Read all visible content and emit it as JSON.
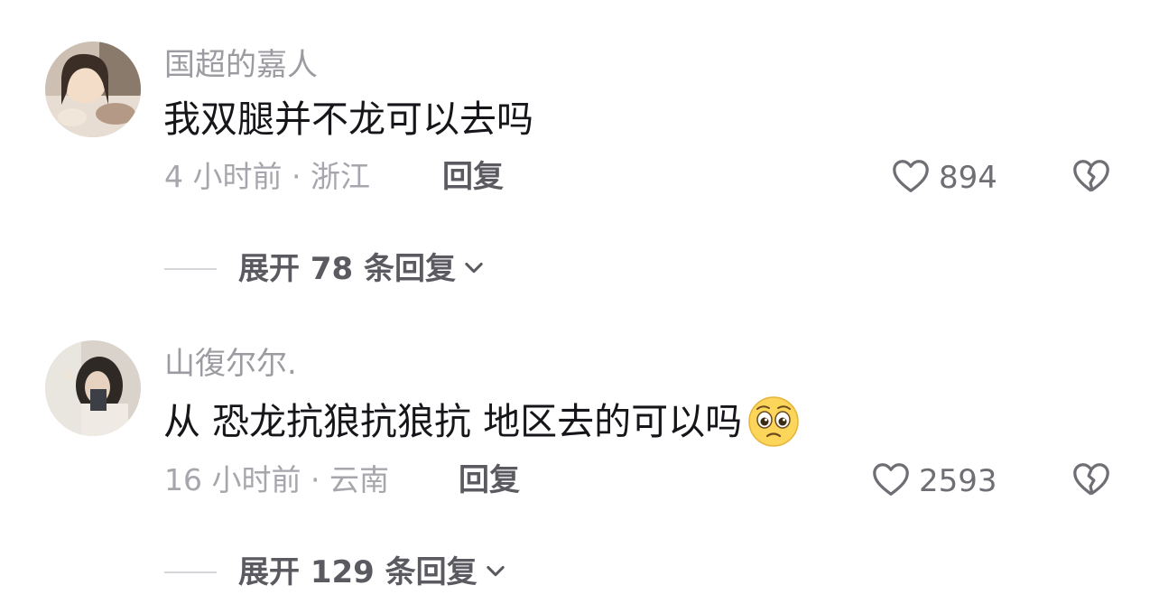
{
  "comments": [
    {
      "username": "国超的嘉人",
      "content": "我双腿并不龙可以去吗",
      "time_location": "4 小时前 · 浙江",
      "reply_label": "回复",
      "likes": "894",
      "expand_label": "展开 78 条回复",
      "has_emoji": false
    },
    {
      "username": "山復尔尔.",
      "content": "从 恐龙抗狼抗狼抗 地区去的可以吗",
      "time_location": "16 小时前 · 云南",
      "reply_label": "回复",
      "likes": "2593",
      "expand_label": "展开 129 条回复",
      "has_emoji": true,
      "emoji": "pleading-face-emoji"
    }
  ],
  "colors": {
    "username": "#9b9ba1",
    "content": "#16161a",
    "meta": "#a6a6ac",
    "action": "#5a5a60",
    "icon": "#6e6e74"
  }
}
